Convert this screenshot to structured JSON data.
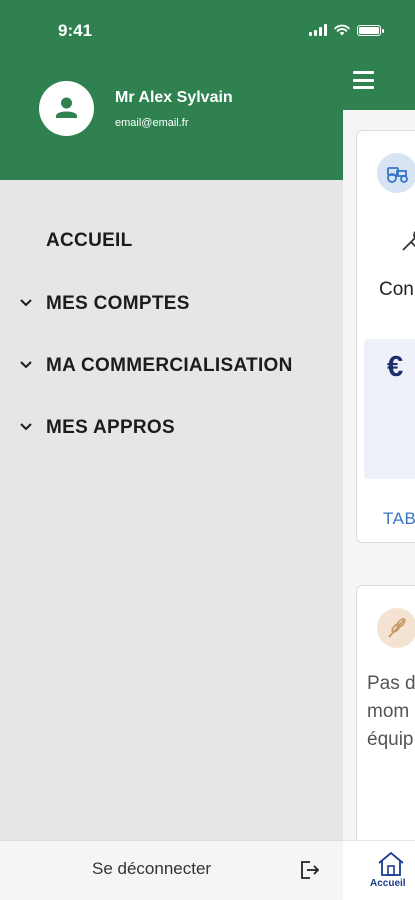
{
  "status_bar": {
    "time": "9:41"
  },
  "drawer": {
    "user": {
      "name": "Mr Alex Sylvain",
      "email": "email@email.fr"
    },
    "menu": [
      {
        "label": "ACCUEIL",
        "has_chevron": false
      },
      {
        "label": "MES COMPTES",
        "has_chevron": true
      },
      {
        "label": "MA COMMERCIALISATION",
        "has_chevron": true
      },
      {
        "label": "MES APPROS",
        "has_chevron": true
      }
    ],
    "logout_label": "Se déconnecter"
  },
  "background_page": {
    "card1": {
      "text": "Con",
      "currency_symbol": "€",
      "link_text": "TAB"
    },
    "card2": {
      "lines": [
        "Pas d",
        "mom",
        "équip"
      ]
    },
    "bottom_nav": {
      "label": "Accueil"
    }
  },
  "colors": {
    "primary_green": "#2f8250",
    "drawer_bg": "#e6e6e6",
    "link_blue": "#3a74c8",
    "navy": "#1a2f6b"
  }
}
